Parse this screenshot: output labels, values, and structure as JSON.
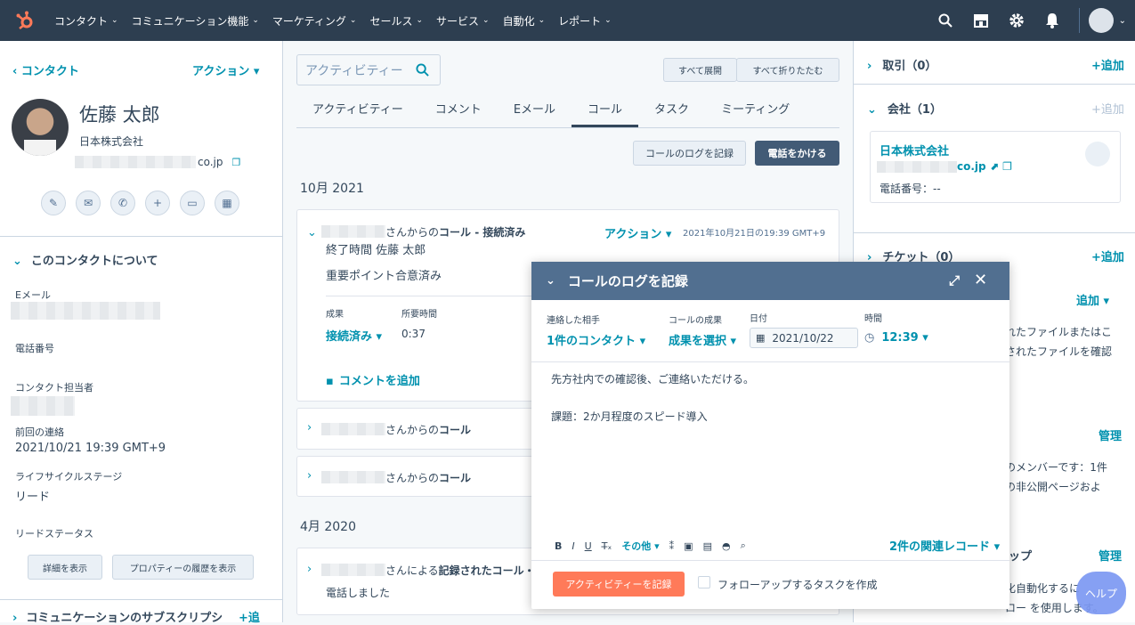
{
  "nav": {
    "items": [
      "コンタクト",
      "コミュニケーション機能",
      "マーケティング",
      "セールス",
      "サービス",
      "自動化",
      "レポート"
    ]
  },
  "left": {
    "back": "コンタクト",
    "actions": "アクション",
    "name": "佐藤 太郎",
    "company": "日本株式会社",
    "email_suffix": "co.jp",
    "about_title": "このコンタクトについて",
    "props": [
      {
        "label": "Eメール",
        "value": ""
      },
      {
        "label": "電話番号",
        "value": ""
      },
      {
        "label": "コンタクト担当者",
        "value": ""
      },
      {
        "label": "前回の連絡",
        "value": "2021/10/21 19:39 GMT+9"
      },
      {
        "label": "ライフサイクルステージ",
        "value": "リード"
      },
      {
        "label": "リードステータス",
        "value": ""
      }
    ],
    "detail_btn": "詳細を表示",
    "history_btn": "プロパティーの履歴を表示",
    "subs_title": "コミュニケーションのサブスクリプシ",
    "subs_add": "+追"
  },
  "center": {
    "search_placeholder": "アクティビティー",
    "expand_all": "すべて展開",
    "collapse_all": "すべて折りたたむ",
    "tabs": [
      "アクティビティー",
      "コメント",
      "Eメール",
      "コール",
      "タスク",
      "ミーティング"
    ],
    "log_call": "コールのログを記録",
    "make_call": "電話をかける",
    "month1": "10月 2021",
    "month2": "4月 2020",
    "card1": {
      "title_suffix": "さんからの",
      "title_bold": "コール - 接続済み",
      "action": "アクション",
      "date": "2021年10月21日の19:39 GMT+9",
      "ended": "終了時間 佐藤 太郎",
      "note": "重要ポイント合意済み",
      "outcome_label": "成果",
      "outcome": "接続済み",
      "duration_label": "所要時間",
      "duration": "0:37",
      "comment": "コメントを追加"
    },
    "card2": {
      "suffix": "さんからの",
      "bold": "コール"
    },
    "card3": {
      "suffix": "さんからの",
      "bold": "コール"
    },
    "card4": {
      "suffix": "さんによる",
      "bold": "記録されたコール・",
      "note": "電話しました"
    }
  },
  "right": {
    "deals": "取引（0）",
    "deals_add": "+追加",
    "companies": "会社（1）",
    "companies_add": "+追加",
    "company_name": "日本株式会社",
    "company_domain": "co.jp",
    "company_phone": "電話番号：--",
    "tickets": "チケット（0）",
    "tickets_add": "+追加",
    "add": "追加",
    "file_text1": "れたファイルまたはこ",
    "file_text2": "されたファイルを確認",
    "manage": "管理",
    "member1": "のメンバーです：1件",
    "member2": "の非公開ページおよ",
    "up": "ップ",
    "manage2": "管理",
    "auto": "化自動化するに",
    "flow": "ロー を使用します。"
  },
  "modal": {
    "title": "コールのログを記録",
    "contacted_label": "連絡した相手",
    "contacted": "1件のコンタクト",
    "outcome_label": "コールの成果",
    "outcome": "成果を選択",
    "date_label": "日付",
    "date": "2021/10/22",
    "time_label": "時間",
    "time": "12:39",
    "line1": "先方社内での確認後、ご連絡いただける。",
    "line2": "課題：2か月程度のスピード導入",
    "more": "その他",
    "related": "2件の関連レコード",
    "submit": "アクティビティーを記録",
    "followup": "フォローアップするタスクを作成"
  },
  "help": "ヘルプ"
}
